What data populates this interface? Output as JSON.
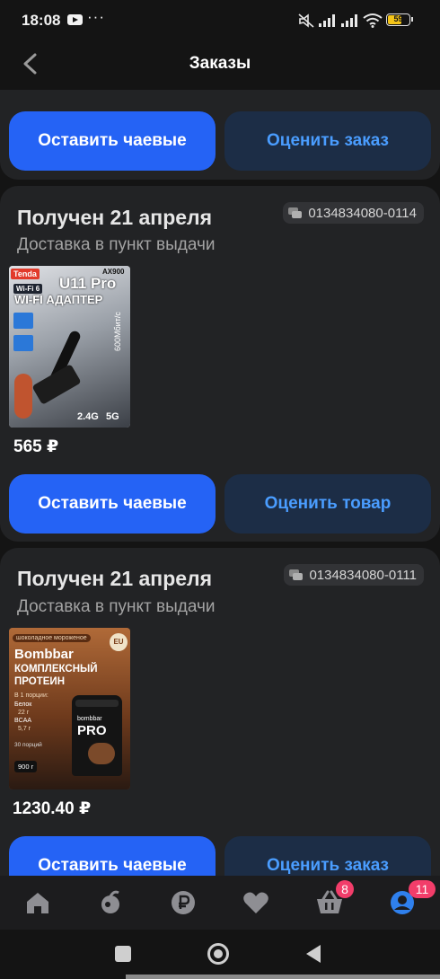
{
  "status_bar": {
    "time": "18:08",
    "more": "···",
    "battery": "59"
  },
  "header": {
    "title": "Заказы"
  },
  "top_card": {
    "tip_label": "Оставить чаевые",
    "rate_label": "Оценить заказ"
  },
  "orders": [
    {
      "status": "Получен 21 апреля",
      "delivery": "Доставка в пункт выдачи",
      "order_number": "0134834080-0114",
      "price": "565 ₽",
      "tip_label": "Оставить чаевые",
      "rate_label": "Оценить товар",
      "image_text": {
        "brand": "Tenda",
        "model_tag": "AX900",
        "model": "U11 Pro",
        "wifi6": "Wi-Fi 6",
        "product": "WI-FI АДАПТЕР",
        "band1": "2.4G",
        "band2": "5G",
        "speed": "600Мбит/с"
      }
    },
    {
      "status": "Получен 21 апреля",
      "delivery": "Доставка в пункт выдачи",
      "order_number": "0134834080-0111",
      "price": "1230.40 ₽",
      "tip_label": "Оставить чаевые",
      "rate_label": "Оценить заказ",
      "image_text": {
        "flavor": "шоколадное мороженое",
        "brand": "Bombbar",
        "product_line1": "КОМПЛЕКСНЫЙ",
        "product_line2": "ПРОТЕИН",
        "per_portion": "В 1 порции:",
        "protein": "Белок",
        "protein_val": "22 г",
        "bcaa": "BCAA",
        "bcaa_val": "5,7 г",
        "portions": "30 порций",
        "weight": "900 г",
        "jar_brand": "bombbar",
        "jar_label": "PRO",
        "eu": "EU"
      }
    }
  ],
  "nav": {
    "cart_badge": "8",
    "profile_badge": "11"
  },
  "colors": {
    "accent": "#2563f5",
    "secondary_text": "#4a9dff",
    "badge": "#f23d6a"
  }
}
